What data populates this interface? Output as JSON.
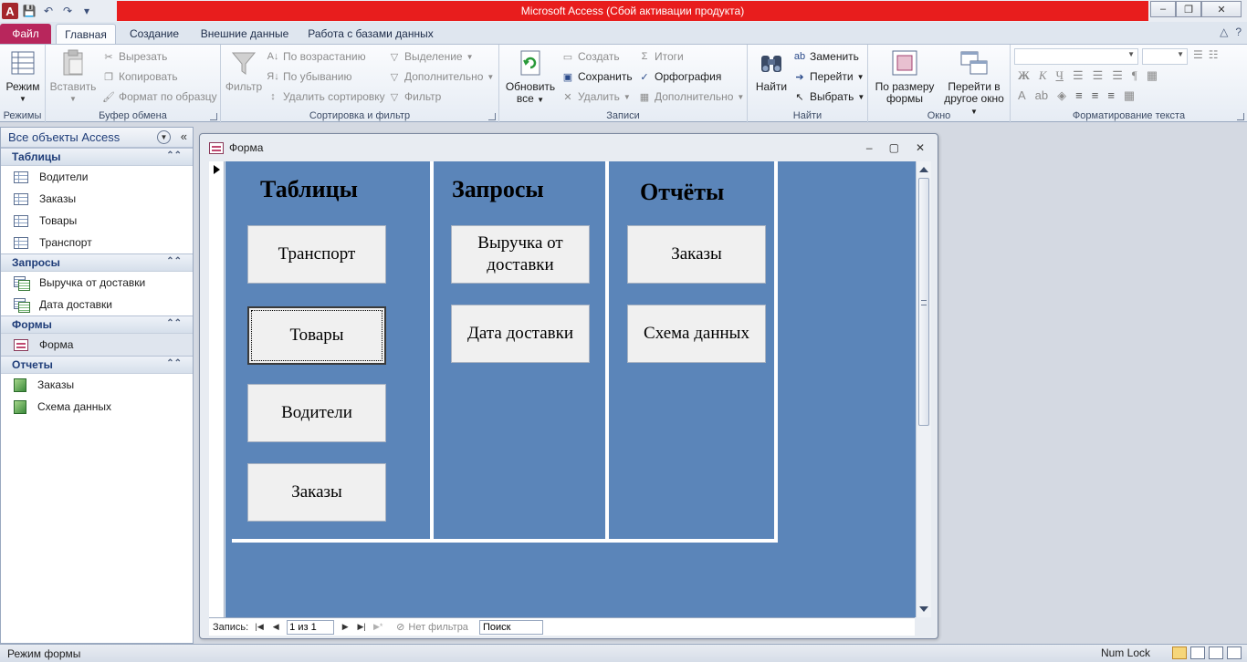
{
  "window": {
    "title": "Microsoft Access (Сбой активации продукта)",
    "app_icon": "A"
  },
  "ribbon_tabs": {
    "file": "Файл",
    "home": "Главная",
    "create": "Создание",
    "external": "Внешние данные",
    "database": "Работа с базами данных"
  },
  "ribbon": {
    "views": {
      "label": "Режимы",
      "view_btn": "Режим"
    },
    "clipboard": {
      "label": "Буфер обмена",
      "paste": "Вставить",
      "cut": "Вырезать",
      "copy": "Копировать",
      "format_painter": "Формат по образцу"
    },
    "sort_filter": {
      "label": "Сортировка и фильтр",
      "filter": "Фильтр",
      "ascending": "По возрастанию",
      "descending": "По убыванию",
      "remove_sort": "Удалить сортировку",
      "selection": "Выделение",
      "advanced": "Дополнительно",
      "toggle_filter": "Фильтр"
    },
    "records": {
      "label": "Записи",
      "refresh_all_1": "Обновить",
      "refresh_all_2": "все",
      "new": "Создать",
      "save": "Сохранить",
      "delete": "Удалить",
      "totals": "Итоги",
      "spelling": "Орфография",
      "more": "Дополнительно"
    },
    "find": {
      "label": "Найти",
      "find": "Найти",
      "replace": "Заменить",
      "goto": "Перейти",
      "select": "Выбрать"
    },
    "window": {
      "label": "Окно",
      "size_to_fit_1": "По размеру",
      "size_to_fit_2": "формы",
      "switch_1": "Перейти в",
      "switch_2": "другое окно"
    },
    "text_format": {
      "label": "Форматирование текста"
    }
  },
  "nav": {
    "header": "Все объекты Access",
    "sections": {
      "tables": {
        "title": "Таблицы",
        "items": [
          "Водители",
          "Заказы",
          "Товары",
          "Транспорт"
        ]
      },
      "queries": {
        "title": "Запросы",
        "items": [
          "Выручка от доставки",
          "Дата доставки"
        ]
      },
      "forms": {
        "title": "Формы",
        "items": [
          "Форма"
        ]
      },
      "reports": {
        "title": "Отчеты",
        "items": [
          "Заказы",
          "Схема данных"
        ]
      }
    }
  },
  "form": {
    "window_title": "Форма",
    "columns": {
      "tables": {
        "title": "Таблицы",
        "buttons": [
          "Транспорт",
          "Товары",
          "Водители",
          "Заказы"
        ]
      },
      "queries": {
        "title": "Запросы",
        "buttons": [
          "Выручка от доставки",
          "Дата доставки"
        ]
      },
      "reports": {
        "title": "Отчёты",
        "buttons": [
          "Заказы",
          "Схема данных"
        ]
      }
    },
    "record_nav": {
      "label": "Запись:",
      "current": "1 из 1",
      "filter_state": "Нет фильтра",
      "search": "Поиск"
    }
  },
  "status": {
    "left": "Режим формы",
    "numlock": "Num Lock"
  },
  "colors": {
    "title_red": "#e81d1d",
    "file_tab": "#b8265c",
    "form_background": "#5b85b9"
  }
}
